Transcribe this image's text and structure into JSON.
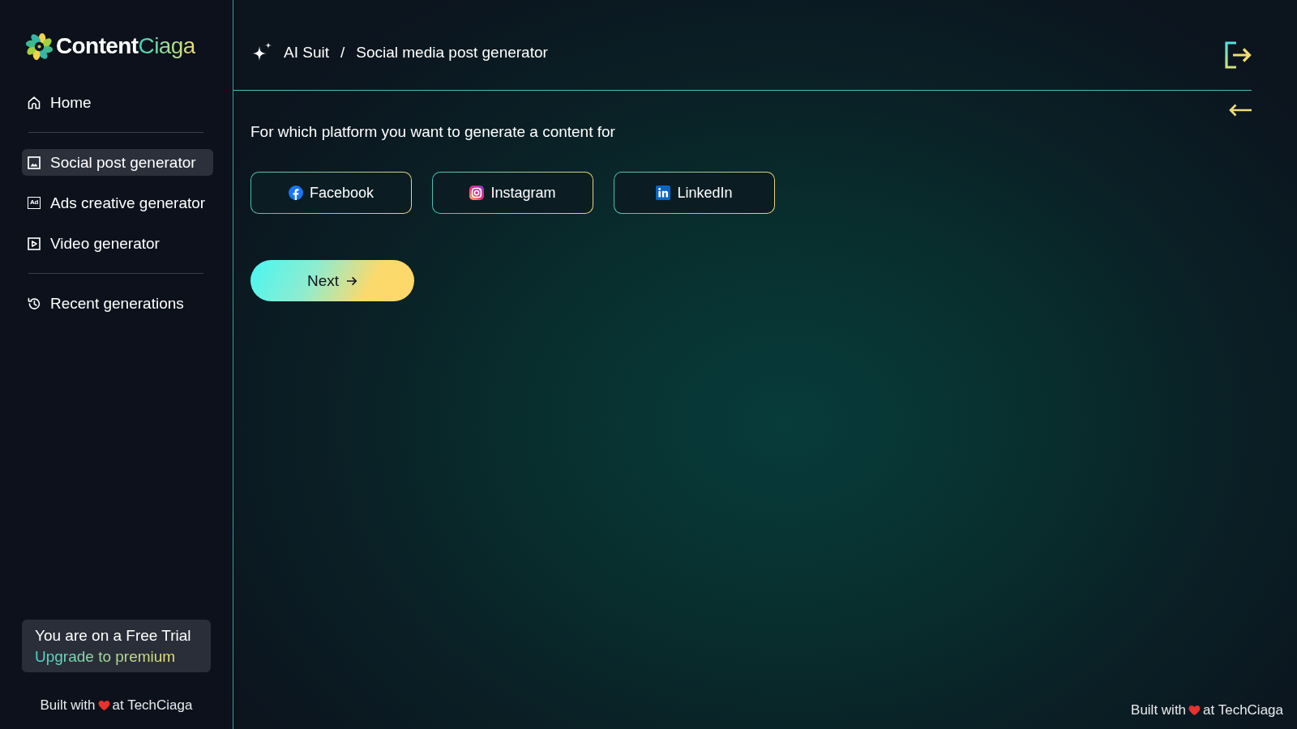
{
  "sidebar": {
    "logo": {
      "name": "Content",
      "name_accent": "Ciaga"
    },
    "nav_groups": [
      {
        "items": [
          {
            "label": "Home",
            "selected": false
          }
        ]
      },
      {
        "items": [
          {
            "label": "Social post generator",
            "selected": true
          },
          {
            "label": "Ads creative generator",
            "icon_text": "Ad",
            "selected": false
          },
          {
            "label": "Video generator",
            "selected": false
          }
        ]
      },
      {
        "items": [
          {
            "label": "Recent generations",
            "selected": false
          }
        ]
      }
    ],
    "trial": {
      "message": "You are on a Free Trial",
      "link": "Upgrade to premium"
    },
    "credit": {
      "lead": "Built with",
      "tail": "at TechCiaga"
    }
  },
  "header": {
    "breadcrumb": [
      "AI Suit",
      "Social media post generator"
    ],
    "separator": "/"
  },
  "main": {
    "question": "For which platform you want to generate a content for",
    "platforms": [
      {
        "label": "Facebook"
      },
      {
        "label": "Instagram"
      },
      {
        "label": "LinkedIn"
      }
    ],
    "next_button": {
      "label": "Next"
    }
  },
  "footer": {
    "credit": {
      "lead": "Built with",
      "tail": "at TechCiaga"
    }
  }
}
